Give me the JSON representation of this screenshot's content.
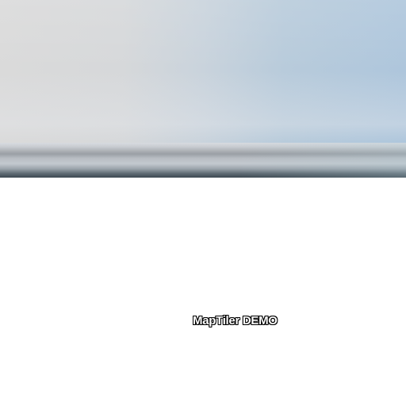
{
  "watermark": {
    "text": "MapTiler DEMO"
  },
  "colors": {
    "sky_left": "#dadada",
    "sky_right": "#aec6dc",
    "ground_dark": "#3d4952",
    "background": "#ffffff"
  }
}
